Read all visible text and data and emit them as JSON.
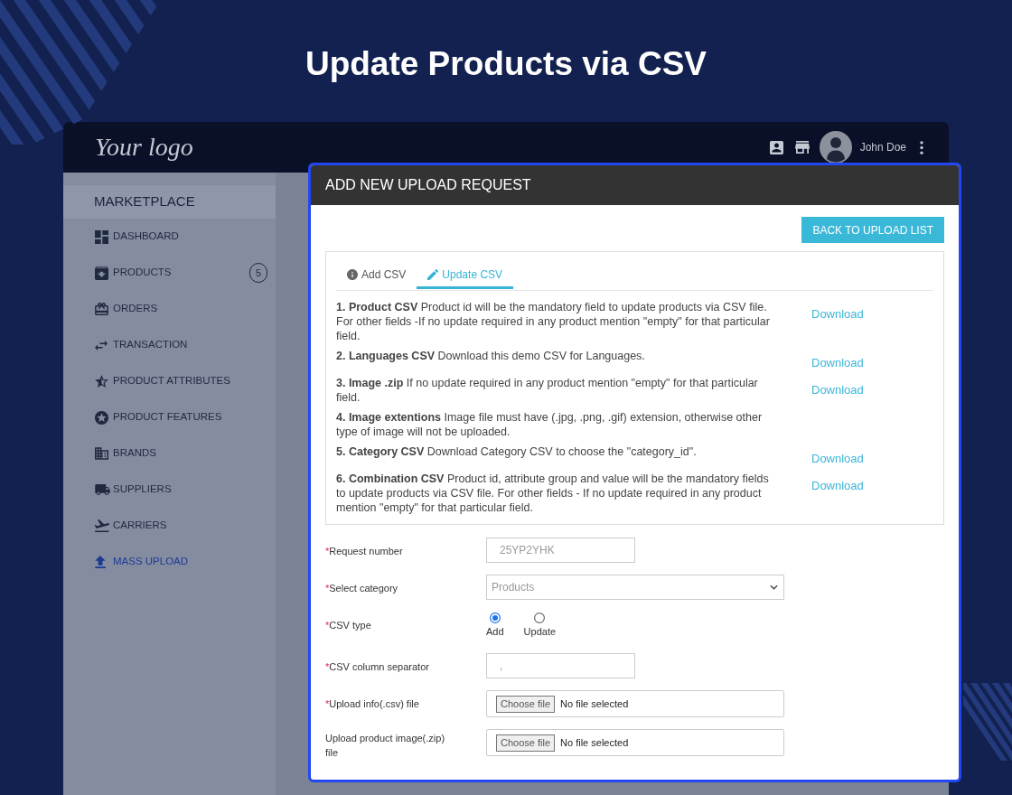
{
  "page_title": "Update Products via CSV",
  "header": {
    "logo": "Your logo",
    "user_name": "John Doe"
  },
  "sidebar": {
    "title": "MARKETPLACE",
    "items": [
      {
        "label": "DASHBOARD",
        "selected": false
      },
      {
        "label": "PRODUCTS",
        "selected": false,
        "badge": "5"
      },
      {
        "label": "ORDERS",
        "selected": false
      },
      {
        "label": "TRANSACTION",
        "selected": false
      },
      {
        "label": "PRODUCT ATTRIBUTES",
        "selected": false
      },
      {
        "label": "PRODUCT FEATURES",
        "selected": false
      },
      {
        "label": "BRANDS",
        "selected": false
      },
      {
        "label": "SUPPLIERS",
        "selected": false
      },
      {
        "label": "CARRIERS",
        "selected": false
      },
      {
        "label": "MASS UPLOAD",
        "selected": true
      }
    ]
  },
  "modal": {
    "title": "ADD NEW UPLOAD REQUEST",
    "back_button": "BACK TO UPLOAD LIST",
    "tabs": [
      {
        "label": "Add CSV",
        "selected": false
      },
      {
        "label": "Update CSV",
        "selected": true
      }
    ],
    "instructions": [
      {
        "text": "**1. Product CSV** Product id will be the mandatory field to update products via CSV file. For other fields -If no update required in any product mention \"empty\" for that particular field.",
        "link": "Download"
      },
      {
        "text": "**2. Languages CSV** Download this demo CSV for Languages.",
        "link": "Download"
      },
      {
        "text": "**3. Image .zip** If no update required in any product mention \"empty\" for that particular field.",
        "link": "Download"
      },
      {
        "text": "**4. Image extentions** Image file must have (.jpg, .png, .gif) extension, otherwise other type of image will not be uploaded."
      },
      {
        "text": "**5. Category CSV** Download Category CSV to choose the \"category_id\".",
        "link": "Download"
      },
      {
        "text": "**6. Combination CSV** Product id, attribute group and value will be the mandatory fields to update products via CSV file. For other fields - If no update required in any product mention \"empty\" for that particular field.",
        "link": "Download"
      }
    ],
    "form": [
      {
        "kind": "text",
        "required_mark": "*",
        "label": "Request number",
        "value": "25YP2YHK"
      },
      {
        "kind": "select",
        "required_mark": "*",
        "label": "Select category",
        "value": "Products"
      },
      {
        "kind": "radio",
        "required_mark": "*",
        "label": "CSV type",
        "options": [
          {
            "label": "Add",
            "selected": true
          },
          {
            "label": "Update",
            "selected": false
          }
        ]
      },
      {
        "kind": "text",
        "required_mark": "*",
        "label": "CSV column separator",
        "value": ","
      },
      {
        "kind": "file",
        "required_mark": "*",
        "label": "Upload info(.csv) file",
        "button": "Choose file",
        "status": "No file selected"
      },
      {
        "kind": "file",
        "label": "Upload product image(.zip) file",
        "button": "Choose file",
        "status": "No file selected"
      }
    ]
  }
}
